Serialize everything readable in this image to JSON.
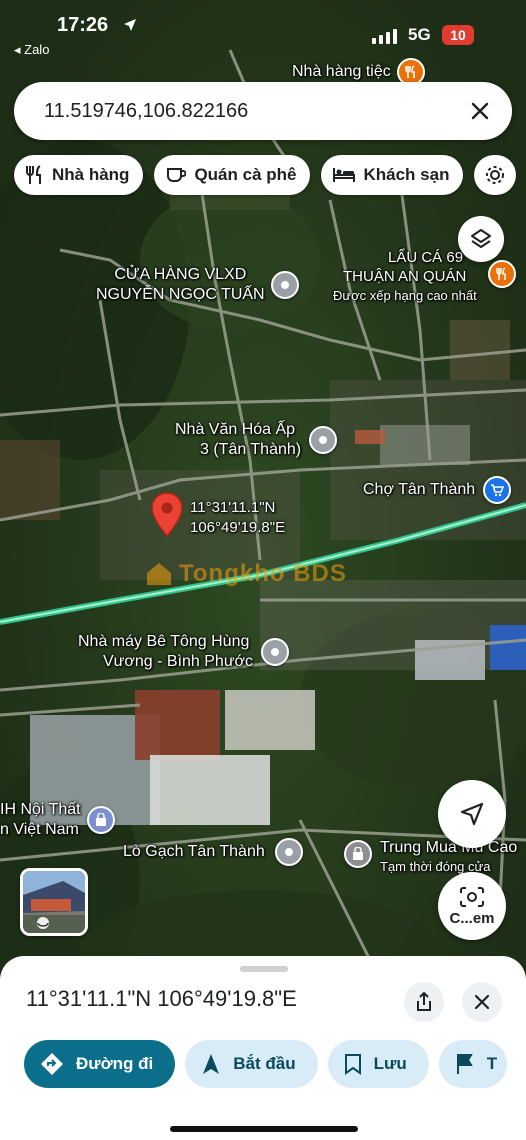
{
  "status_bar": {
    "time": "17:26",
    "back_app": "◂ Zalo",
    "network": "5G",
    "battery": "10"
  },
  "search": {
    "query": "11.519746,106.822166"
  },
  "chips": [
    {
      "label": "Nhà hàng",
      "icon": "fork-knife-icon"
    },
    {
      "label": "Quán cà phê",
      "icon": "coffee-cup-icon"
    },
    {
      "label": "Khách sạn",
      "icon": "bed-icon"
    }
  ],
  "map": {
    "pois": {
      "nha_hang_tiec": "Nhà hàng tiệc",
      "vlxd_line1": "CỬA HÀNG VLXD",
      "vlxd_line2": "NGUYỄN NGỌC TUẤN",
      "lau_ca_line1": "LẨU CÁ 69",
      "lau_ca_line2": "THUẬN AN QUÁN",
      "lau_ca_sub": "Được xếp hạng cao nhất",
      "van_hoa_line1": "Nhà Văn Hóa Ấp",
      "van_hoa_line2": "3 (Tân Thành)",
      "cho_tan_thanh": "Chợ Tân Thành",
      "be_tong_line1": "Nhà máy Bê Tông Hùng",
      "be_tong_line2": "Vương - Bình Phước",
      "noi_that_line1": "IH Nội Thất",
      "noi_that_line2": "n Việt Nam",
      "lo_gach": "Lò Gạch Tân Thành",
      "trung_mua_line1": "Trung Mua Mủ Cao",
      "trung_mua_line2": "Tạm thời đóng cửa"
    },
    "pin_label_line1": "11°31'11.1\"N",
    "pin_label_line2": "106°49'19.8\"E",
    "watermark": "Tongkho BDS",
    "camera_label": "C...em"
  },
  "sheet": {
    "coords": "11°31'11.1\"N 106°49'19.8\"E",
    "actions": [
      {
        "label": "Đường đi",
        "icon": "directions-icon"
      },
      {
        "label": "Bắt đầu",
        "icon": "navigation-arrow-icon"
      },
      {
        "label": "Lưu",
        "icon": "bookmark-icon"
      },
      {
        "label": "T",
        "icon": "flag-icon"
      }
    ]
  },
  "colors": {
    "accent": "#0b6e8a",
    "road_highlight": "#34d399",
    "pin_red": "#ea4335"
  }
}
